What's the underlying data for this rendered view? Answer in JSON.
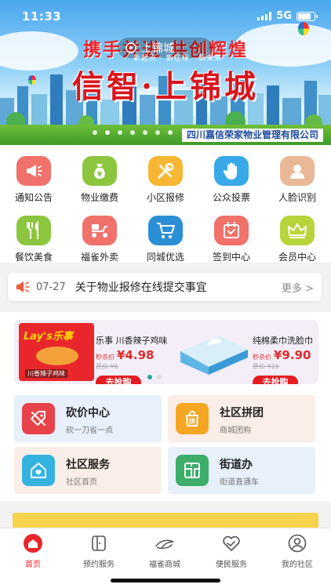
{
  "status_bar": {
    "time": "11:33",
    "network": "5G"
  },
  "banner": {
    "slogan": "携手并进 共创辉煌",
    "search_text": "上锦城",
    "subtitle": "新起点 · 新征程 · 新未来",
    "title": "信智·上锦城",
    "company": "四川嘉信荣家物业管理有限公司",
    "page_count": 7,
    "active_page": 2
  },
  "menu": {
    "items": [
      {
        "label": "通知公告",
        "icon": "megaphone-icon",
        "color": "#f0726a"
      },
      {
        "label": "物业缴费",
        "icon": "money-bag-icon",
        "color": "#8cc63f"
      },
      {
        "label": "小区报修",
        "icon": "tools-icon",
        "color": "#f7b733"
      },
      {
        "label": "公众投票",
        "icon": "hand-icon",
        "color": "#38a9e8"
      },
      {
        "label": "人脸识别",
        "icon": "person-icon",
        "color": "#e9b896"
      },
      {
        "label": "餐饮美食",
        "icon": "utensils-icon",
        "color": "#8cc63f"
      },
      {
        "label": "福雀外卖",
        "icon": "scooter-icon",
        "color": "#f0726a"
      },
      {
        "label": "同城优选",
        "icon": "cart-icon",
        "color": "#2b8fd6"
      },
      {
        "label": "签到中心",
        "icon": "calendar-check-icon",
        "color": "#f0726a"
      },
      {
        "label": "会员中心",
        "icon": "crown-icon",
        "color": "#b7d43a"
      }
    ]
  },
  "notice": {
    "date": "07-27",
    "text": "关于物业报修在线提交事宜",
    "more": "更多 >"
  },
  "promo": {
    "products": [
      {
        "name": "乐事 川香辣子鸡味",
        "price_label": "秒杀价",
        "price": "¥4.98",
        "old_price": "原价 ¥6",
        "buy": "去抢购",
        "brand": "Lay's乐事",
        "flavor": "川香辣子鸡味"
      },
      {
        "name": "纯棉柔巾洗脸巾",
        "price_label": "秒杀价",
        "price": "¥9.90",
        "old_price": "原价 ¥15",
        "buy": "去抢购"
      }
    ]
  },
  "tiles": [
    {
      "title": "砍价中心",
      "subtitle": "砍一刀省一点",
      "icon": "price-tag-icon",
      "color": "#e8434a",
      "bg": "#e8f0fb"
    },
    {
      "title": "社区拼团",
      "subtitle": "商城团购",
      "icon": "group-buy-icon",
      "color": "#f5a623",
      "bg": "#fbeee9"
    },
    {
      "title": "社区服务",
      "subtitle": "社区首页",
      "icon": "house-heart-icon",
      "color": "#35b3e0",
      "bg": "#fbeee9"
    },
    {
      "title": "街道办",
      "subtitle": "街道直通车",
      "icon": "map-grid-icon",
      "color": "#3cae6a",
      "bg": "#e8f0fb"
    }
  ],
  "tabbar": {
    "tabs": [
      {
        "label": "首页",
        "icon": "home-icon",
        "active": true
      },
      {
        "label": "预约服务",
        "icon": "door-icon",
        "active": false
      },
      {
        "label": "福雀商城",
        "icon": "bird-icon",
        "active": false
      },
      {
        "label": "便民服务",
        "icon": "handshake-heart-icon",
        "active": false
      },
      {
        "label": "我的社区",
        "icon": "user-icon",
        "active": false
      }
    ]
  },
  "colors": {
    "accent": "#e8262d"
  }
}
